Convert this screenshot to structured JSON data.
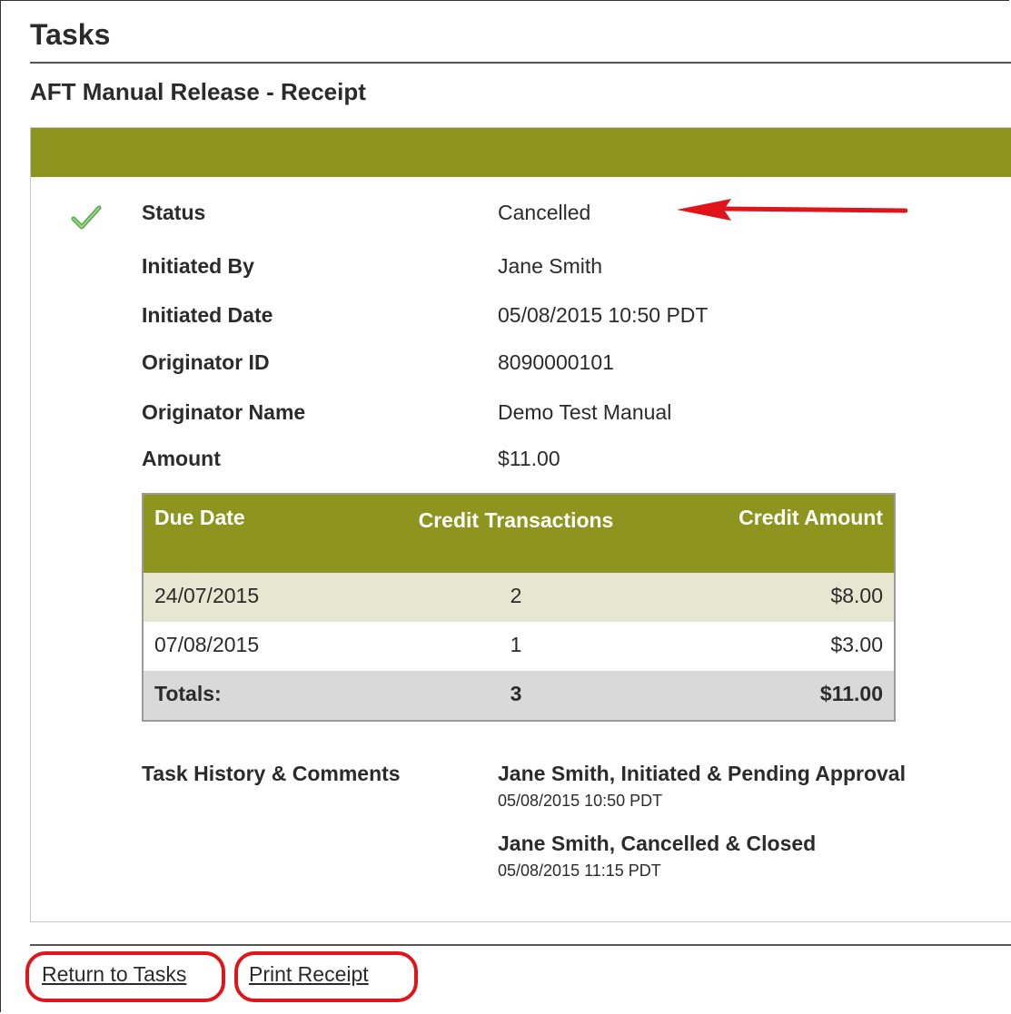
{
  "page": {
    "title": "Tasks",
    "subtitle": "AFT Manual Release - Receipt"
  },
  "details": [
    {
      "label": "Status",
      "value": "Cancelled"
    },
    {
      "label": "Initiated By",
      "value": "Jane Smith"
    },
    {
      "label": "Initiated Date",
      "value": "05/08/2015 10:50 PDT"
    },
    {
      "label": "Originator ID",
      "value": "8090000101"
    },
    {
      "label": "Originator Name",
      "value": "Demo Test Manual"
    },
    {
      "label": "Amount",
      "value": "$11.00"
    }
  ],
  "status_icon": "check-icon",
  "due_table": {
    "headers": [
      "Due Date",
      "Credit Transactions",
      "Credit Amount"
    ],
    "rows": [
      {
        "due_date": "24/07/2015",
        "credit_transactions": "2",
        "credit_amount": "$8.00"
      },
      {
        "due_date": "07/08/2015",
        "credit_transactions": "1",
        "credit_amount": "$3.00"
      }
    ],
    "totals": {
      "label": "Totals:",
      "credit_transactions": "3",
      "credit_amount": "$11.00"
    }
  },
  "history": {
    "label": "Task History & Comments",
    "entries": [
      {
        "title": "Jane Smith, Initiated & Pending Approval",
        "time": "05/08/2015 10:50 PDT"
      },
      {
        "title": "Jane Smith, Cancelled & Closed",
        "time": "05/08/2015 11:15 PDT"
      }
    ]
  },
  "links": {
    "return_to_tasks": "Return to Tasks",
    "print_receipt": "Print Receipt"
  },
  "colors": {
    "header_olive": "#8d951f",
    "row_alt": "#e6e6d1",
    "totals_row": "#d9d9d9",
    "annotation_red": "#e0141b",
    "check_green": "#4caf50"
  }
}
